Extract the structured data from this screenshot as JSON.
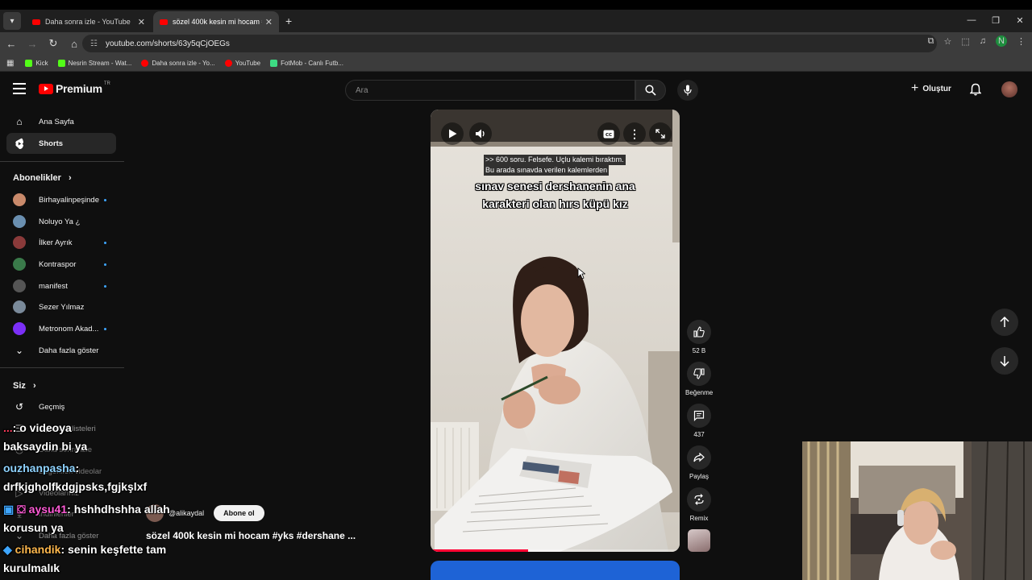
{
  "browser": {
    "tabs": [
      {
        "title": "Daha sonra izle - YouTube",
        "active": false
      },
      {
        "title": "sözel 400k kesin mi hocam #yk",
        "active": true
      }
    ],
    "url": "youtube.com/shorts/63y5qCjOEGs",
    "profile_initial": "N",
    "bookmarks": [
      {
        "label": "Kick",
        "color": "#53fc18"
      },
      {
        "label": "Nesrin Stream - Wat...",
        "color": "#53fc18"
      },
      {
        "label": "Daha sonra izle - Yo...",
        "color": "#ff0000"
      },
      {
        "label": "YouTube",
        "color": "#ff0000"
      },
      {
        "label": "FotMob - Canlı Futb...",
        "color": "#3ddc84"
      }
    ]
  },
  "youtube": {
    "logo_text": "Premium",
    "logo_region": "TR",
    "search_placeholder": "Ara",
    "create_label": "Oluştur"
  },
  "guide": {
    "main": [
      {
        "label": "Ana Sayfa",
        "icon": "home-icon"
      },
      {
        "label": "Shorts",
        "icon": "shorts-icon",
        "selected": true
      }
    ],
    "subs_header": "Abonelikler",
    "subscriptions": [
      {
        "label": "Birhayalinpeşinde",
        "dot": true,
        "color": "#c98a6b"
      },
      {
        "label": "Noluyo Ya ¿",
        "dot": false,
        "color": "#6a8fb0"
      },
      {
        "label": "İlker Ayrık",
        "dot": true,
        "color": "#8a3a3a"
      },
      {
        "label": "Kontraspor",
        "dot": true,
        "color": "#3a7a4a"
      },
      {
        "label": "manifest",
        "dot": true,
        "color": "#555555"
      },
      {
        "label": "Sezer Yılmaz",
        "dot": false,
        "color": "#7a8a9a"
      },
      {
        "label": "Metronom Akad...",
        "dot": true,
        "color": "#7b2ff7"
      }
    ],
    "show_more": "Daha fazla göster",
    "you_header": "Siz",
    "you_items": [
      {
        "label": "Geçmiş",
        "icon": "history-icon"
      },
      {
        "label": "Oynatma listeleri",
        "icon": "playlist-icon"
      },
      {
        "label": "Daha sonra izle",
        "icon": "watch-later-icon"
      },
      {
        "label": "Beğenilen videolar",
        "icon": "like-icon"
      },
      {
        "label": "Videolarınız",
        "icon": "video-icon"
      },
      {
        "label": "İndirilenler",
        "icon": "download-icon"
      }
    ],
    "show_more_2": "Daha fazla göster"
  },
  "chat": [
    {
      "user": "...",
      "text": ": o videoya"
    },
    {
      "user": "",
      "text": "baksaydin bi ya"
    },
    {
      "user": "ouzhanpasha",
      "text": ":"
    },
    {
      "user": "",
      "text": "drfkjgholfkdgjpsks,fgjkşlxf"
    },
    {
      "user": "aysu41",
      "text": ": hshhdhshha allah"
    },
    {
      "user": "",
      "text": "korusun ya"
    },
    {
      "user": "cihandik",
      "text": ": senin keşfette tam"
    },
    {
      "user": "",
      "text": "kurulmalık"
    }
  ],
  "short": {
    "caption_small_1": ">> 600 soru. Felsefe. Uçlu kalemi bıraktım.",
    "caption_small_2": "Bu arada sınavda verilen kalemlerden",
    "caption_big_1": "sınav senesi dershanenin ana",
    "caption_big_2": "karakteri olan hırs küpü kız",
    "channel": "@alikaydal",
    "subscribe_label": "Abone ol",
    "title": "sözel 400k kesin mi hocam #yks #dershane ...",
    "progress": 0.39
  },
  "actions": {
    "likes": "52 B",
    "dislike_label": "Beğenme",
    "comments": "437",
    "share_label": "Paylaş",
    "remix_label": "Remix"
  }
}
